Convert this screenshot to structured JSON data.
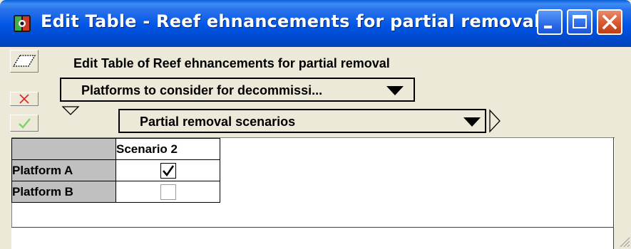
{
  "window": {
    "title": "Edit Table - Reef ehnancements for partial removal",
    "icons": {
      "app": "analytica-icon",
      "minimize": "minimize-icon",
      "maximize": "maximize-icon",
      "close": "close-icon"
    }
  },
  "toolbar": {
    "edit_icon": "edit-parallelogram-icon",
    "cancel_icon": "x-cancel-icon",
    "accept_icon": "checkmark-accept-icon"
  },
  "heading": "Edit Table of Reef ehnancements for partial removal",
  "row_index_dropdown": {
    "label": "Platforms to consider for decommissi..."
  },
  "column_index_dropdown": {
    "label": "Partial removal scenarios"
  },
  "table": {
    "column_headers": [
      "Scenario 2"
    ],
    "rows": [
      {
        "label": "Platform A",
        "checked": true
      },
      {
        "label": "Platform B",
        "checked": false
      }
    ]
  },
  "colors": {
    "titlebar": "#0055e5",
    "face": "#ece9d8",
    "header_cell": "#c0c0c0",
    "close_button": "#d8522a"
  }
}
